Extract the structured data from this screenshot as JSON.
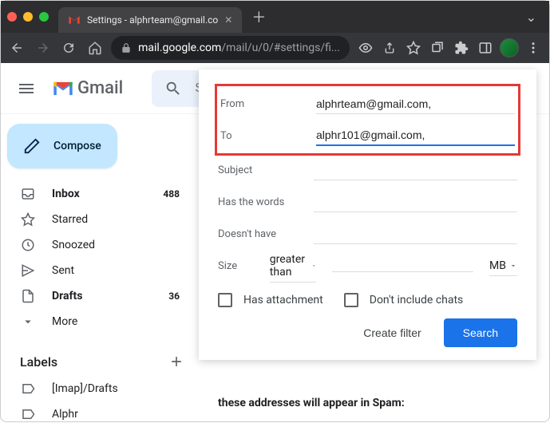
{
  "browser": {
    "tab_title": "Settings - alphrteam@gmail.co",
    "url_host": "mail.google.com",
    "url_path": "/mail/u/0/#settings/fi..."
  },
  "header": {
    "product": "Gmail",
    "search_placeholder": "Search in mail"
  },
  "sidebar": {
    "compose_label": "Compose",
    "items": [
      {
        "icon": "inbox",
        "label": "Inbox",
        "count": "488",
        "bold": true
      },
      {
        "icon": "star",
        "label": "Starred",
        "count": ""
      },
      {
        "icon": "snooze",
        "label": "Snoozed",
        "count": ""
      },
      {
        "icon": "sent",
        "label": "Sent",
        "count": ""
      },
      {
        "icon": "drafts",
        "label": "Drafts",
        "count": "36",
        "bold": true
      },
      {
        "icon": "more",
        "label": "More",
        "count": ""
      }
    ],
    "labels_header": "Labels",
    "labels": [
      {
        "label": "[Imap]/Drafts"
      },
      {
        "label": "Alphr"
      }
    ]
  },
  "search_form": {
    "from_label": "From",
    "from_value": "alphrteam@gmail.com,",
    "to_label": "To",
    "to_value": "alphr101@gmail.com,",
    "subject_label": "Subject",
    "has_words_label": "Has the words",
    "doesnt_have_label": "Doesn't have",
    "size_label": "Size",
    "size_op": "greater than",
    "size_unit": "MB",
    "has_attachment_label": "Has attachment",
    "dont_include_chats_label": "Don't include chats",
    "create_filter_label": "Create filter",
    "search_button_label": "Search"
  },
  "bg_text": "these addresses will appear in Spam:"
}
